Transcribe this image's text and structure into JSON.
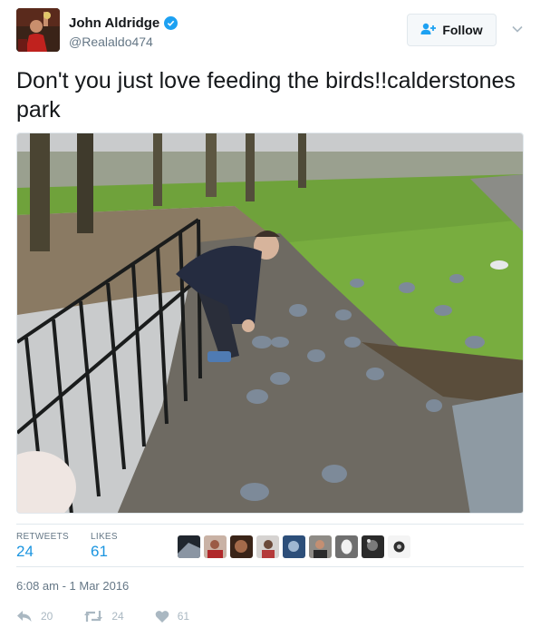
{
  "user": {
    "display_name": "John Aldridge",
    "handle": "@Realaldo474",
    "verified": true
  },
  "follow_button": {
    "label": "Follow",
    "icon": "add-user-icon"
  },
  "tweet": {
    "text": "Don't you just love feeding the birds!!calderstones park",
    "photo_alt": "photo-man-feeding-pigeons-in-park"
  },
  "stats": {
    "retweets_label": "RETWEETS",
    "retweets_value": "24",
    "likes_label": "LIKES",
    "likes_value": "61"
  },
  "likers_count": 9,
  "timestamp": "6:08 am - 1 Mar 2016",
  "actions": {
    "reply_count": "20",
    "retweet_count": "24",
    "like_count": "61"
  },
  "colors": {
    "accent": "#1da1f2",
    "stat_value": "#1b95e0",
    "muted": "#657786",
    "icon_muted": "#aab8c2",
    "border": "#e1e8ed"
  }
}
